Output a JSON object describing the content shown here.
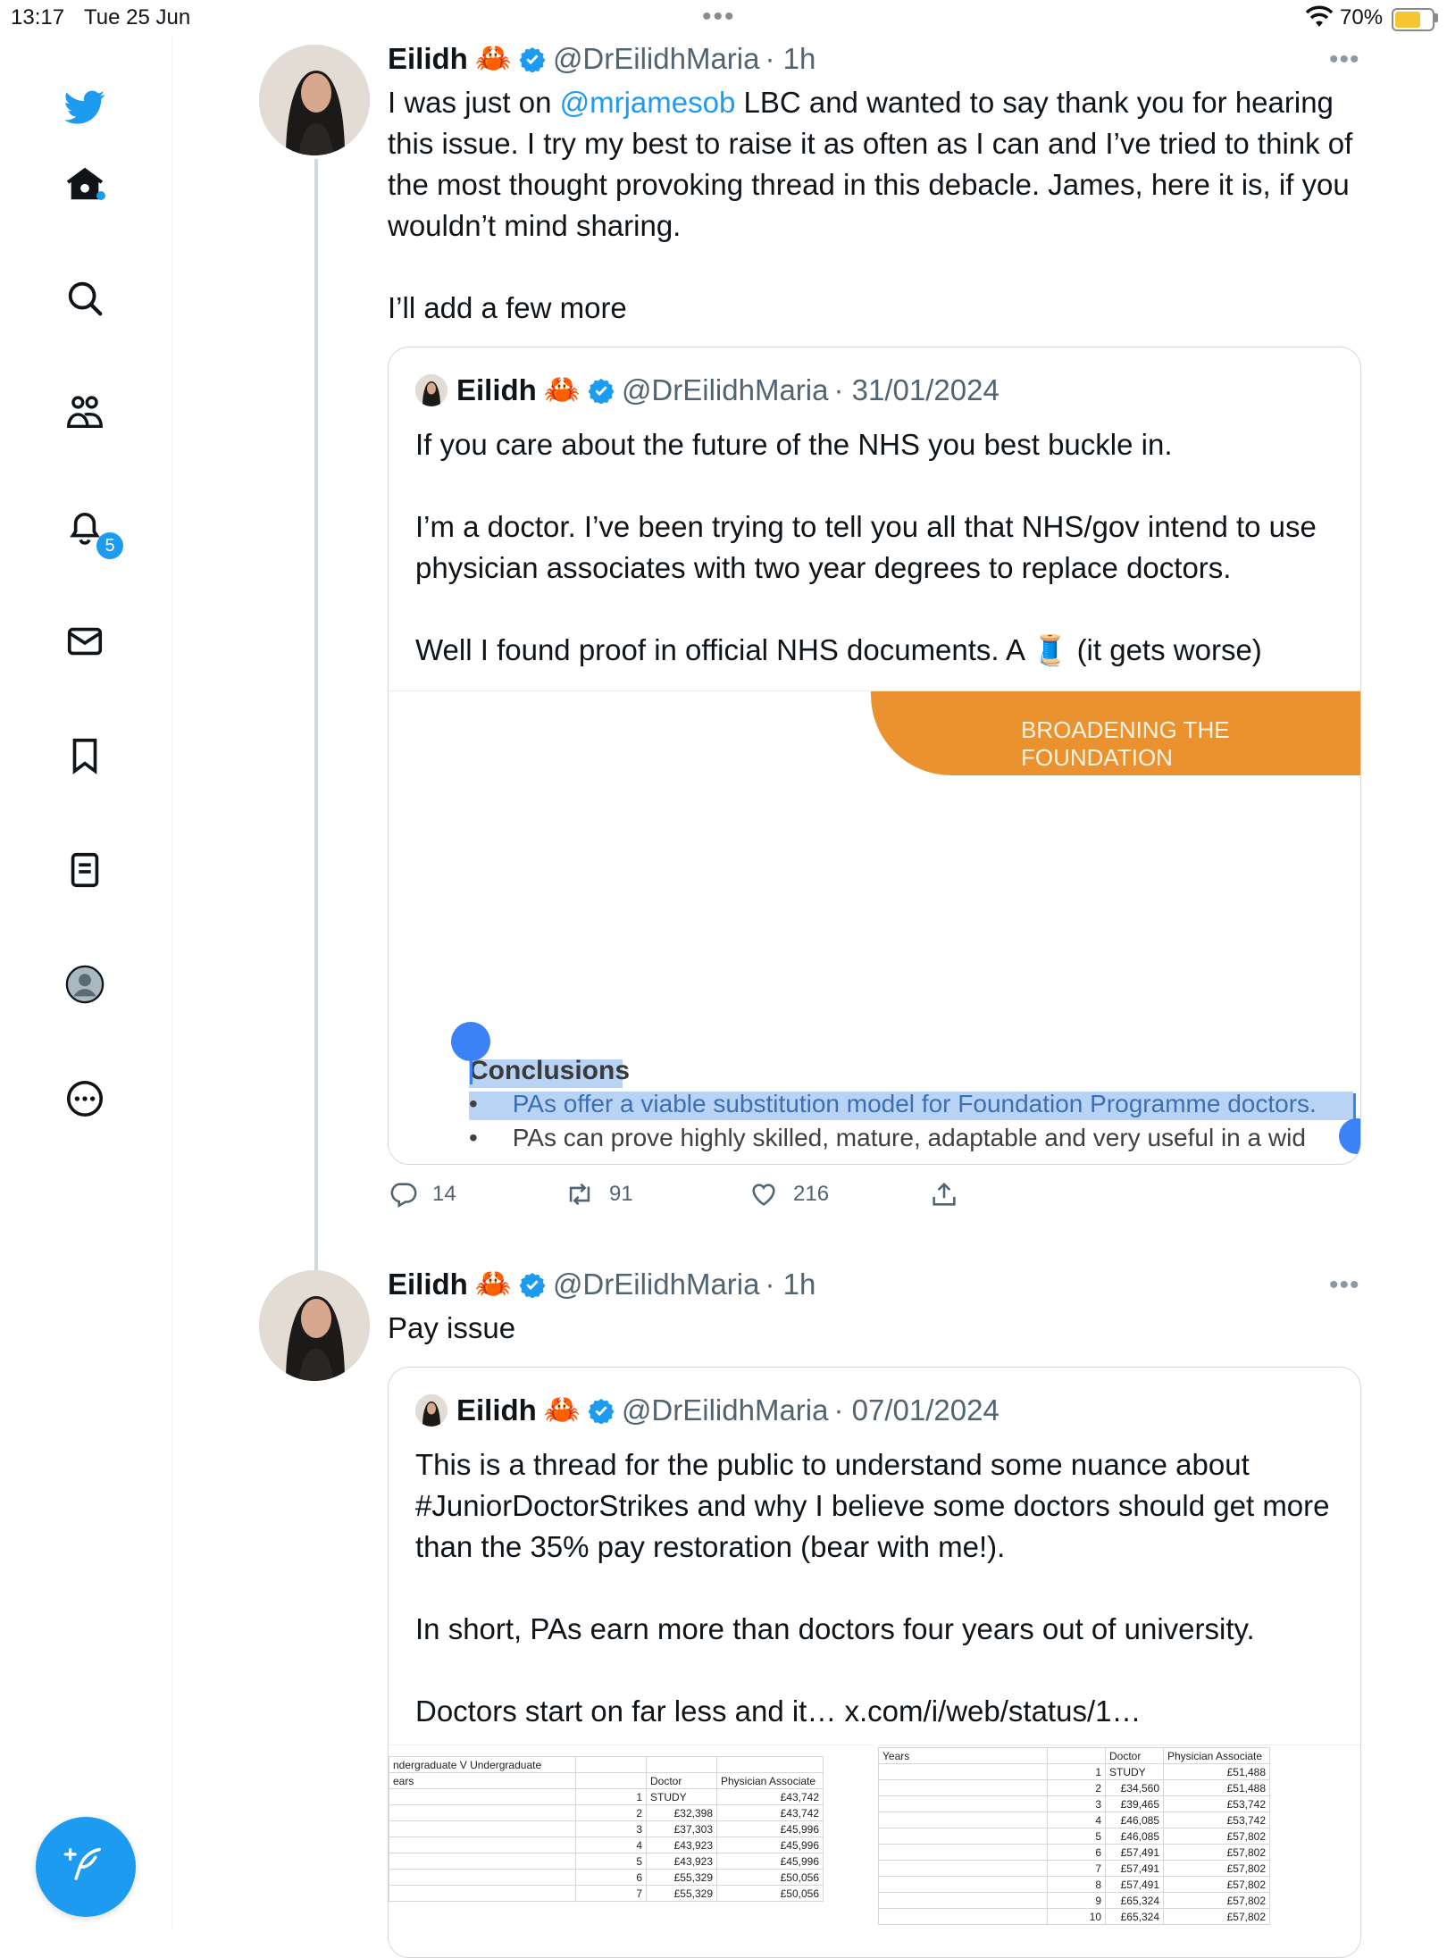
{
  "status_bar": {
    "time": "13:17",
    "date": "Tue 25 Jun",
    "dots": "•••",
    "battery_pct": "70%",
    "battery_level": 0.7,
    "battery_color": "#f7c531"
  },
  "sidebar": {
    "items": [
      {
        "name": "twitter-logo-icon"
      },
      {
        "name": "home-icon"
      },
      {
        "name": "search-icon"
      },
      {
        "name": "communities-icon"
      },
      {
        "name": "notifications-icon"
      },
      {
        "name": "messages-icon"
      },
      {
        "name": "bookmarks-icon"
      },
      {
        "name": "lists-icon"
      },
      {
        "name": "profile-icon"
      },
      {
        "name": "more-icon"
      }
    ],
    "notifications_badge": "5",
    "compose_icon": "feather-plus-icon"
  },
  "tweets": [
    {
      "name": "Eilidh",
      "emoji": "🦀",
      "handle": "@DrEilidhMaria",
      "time": "· 1h",
      "more": "•••",
      "text_before": "I was just on ",
      "mention": "@mrjamesob",
      "text_after": " LBC and wanted to say thank you for hearing this issue. I try my best to raise it as often as I can and I’ve tried to think of the most thought provoking thread in this debacle. James, here it is, if you wouldn’t mind sharing.\n\nI’ll add a few more",
      "quote": {
        "name": "Eilidh",
        "emoji": "🦀",
        "handle": "@DrEilidhMaria",
        "time": "· 31/01/2024",
        "text": "If you care about the future of the NHS you best buckle in.\n\nI’m a doctor. I’ve been trying to tell you all that NHS/gov intend to use physician associates with two year degrees to replace doctors.\n\nWell I found proof in official NHS documents. A 🧵 (it gets worse)",
        "image": {
          "banner": "BROADENING THE FOUNDATION",
          "heading": "Conclusions",
          "bullets": [
            "PAs offer a viable substitution model for Foundation Programme doctors.",
            "PAs can prove highly skilled, mature, adaptable and very useful in a wid"
          ]
        }
      },
      "actions": {
        "replies": "14",
        "retweets": "91",
        "likes": "216"
      }
    },
    {
      "name": "Eilidh",
      "emoji": "🦀",
      "handle": "@DrEilidhMaria",
      "time": "· 1h",
      "more": "•••",
      "text": "Pay issue",
      "quote": {
        "name": "Eilidh",
        "emoji": "🦀",
        "handle": "@DrEilidhMaria",
        "time": "· 07/01/2024",
        "text": "This is a thread for the public to understand some nuance about #JuniorDoctorStrikes and why I believe some doctors should get more than the 35% pay restoration (bear with me!).\n\nIn short, PAs earn more than doctors four years out of university.\n\nDoctors start on far less and it… x.com/i/web/status/1…",
        "sheet_left": {
          "title": "ndergraduate V Undergraduate",
          "col0": "ears",
          "headers": [
            "Doctor",
            "Physician Associate"
          ],
          "rows": [
            [
              "1",
              "STUDY",
              "£43,742"
            ],
            [
              "2",
              "£32,398",
              "£43,742"
            ],
            [
              "3",
              "£37,303",
              "£45,996"
            ],
            [
              "4",
              "£43,923",
              "£45,996"
            ],
            [
              "5",
              "£43,923",
              "£45,996"
            ],
            [
              "6",
              "£55,329",
              "£50,056"
            ],
            [
              "7",
              "£55,329",
              "£50,056"
            ]
          ]
        },
        "sheet_right": {
          "col0": "Years",
          "headers": [
            "Doctor",
            "Physician Associate"
          ],
          "rows": [
            [
              "1",
              "STUDY",
              "£51,488"
            ],
            [
              "2",
              "£34,560",
              "£51,488"
            ],
            [
              "3",
              "£39,465",
              "£53,742"
            ],
            [
              "4",
              "£46,085",
              "£53,742"
            ],
            [
              "5",
              "£46,085",
              "£57,802"
            ],
            [
              "6",
              "£57,491",
              "£57,802"
            ],
            [
              "7",
              "£57,491",
              "£57,802"
            ],
            [
              "8",
              "£57,491",
              "£57,802"
            ],
            [
              "9",
              "£65,324",
              "£57,802"
            ],
            [
              "10",
              "£65,324",
              "£57,802"
            ]
          ]
        }
      }
    }
  ],
  "colors": {
    "accent": "#1d9bf0",
    "secondary_text": "#536471"
  }
}
